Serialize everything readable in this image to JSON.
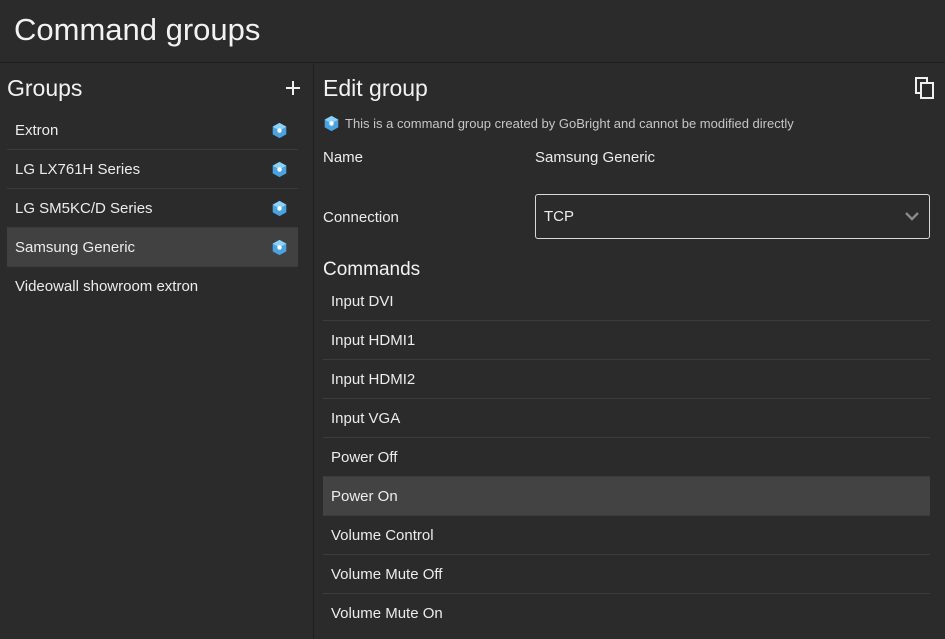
{
  "header": {
    "title": "Command groups"
  },
  "sidebar": {
    "title": "Groups",
    "add_icon": "plus-icon",
    "items": [
      {
        "label": "Extron",
        "badge": "gobright-icon"
      },
      {
        "label": "LG LX761H Series",
        "badge": "gobright-icon"
      },
      {
        "label": "LG SM5KC/D Series",
        "badge": "gobright-icon"
      },
      {
        "label": "Samsung Generic",
        "badge": "gobright-icon",
        "selected": true
      },
      {
        "label": "Videowall showroom extron",
        "badge": null
      }
    ]
  },
  "main": {
    "title": "Edit group",
    "copy_icon": "copy-icon",
    "notice": "This is a command group created by GoBright and cannot be modified directly",
    "name_label": "Name",
    "name_value": "Samsung Generic",
    "connection_label": "Connection",
    "connection_value": "TCP",
    "commands_title": "Commands",
    "commands": [
      "Input DVI",
      "Input HDMI1",
      "Input HDMI2",
      "Input VGA",
      "Power Off",
      "Power On",
      "Volume Control",
      "Volume Mute Off",
      "Volume Mute On"
    ]
  },
  "colors": {
    "background": "#2b2b2b",
    "selected_row": "#414141",
    "badge_blue": "#4aa3df",
    "text": "#ececec"
  }
}
